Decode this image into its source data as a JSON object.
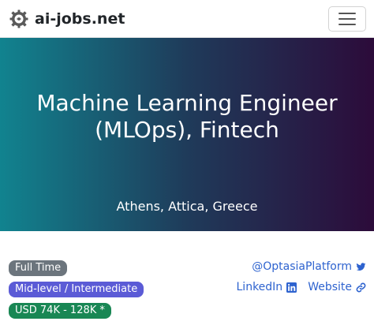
{
  "navbar": {
    "brand": "ai-jobs.net",
    "logo_icon": "gear-brain-logo-icon",
    "menu_icon": "hamburger-menu-icon"
  },
  "hero": {
    "title": "Machine Learning Engineer (MLOps), Fintech",
    "location": "Athens, Attica, Greece",
    "gradient": [
      "#11838f",
      "#1f3b5a",
      "#2c0b3a"
    ]
  },
  "badges": {
    "employment_type": "Full Time",
    "employment_type_color": "#6c757d",
    "level": "Mid-level / Intermediate",
    "level_color": "#5b5bd6",
    "salary": "USD 74K - 128K *",
    "salary_color": "#198754"
  },
  "links": {
    "twitter_handle": "@OptasiaPlatform",
    "twitter_icon": "twitter-icon",
    "linkedin_label": "LinkedIn",
    "linkedin_icon": "linkedin-icon",
    "website_label": "Website",
    "website_icon": "link-icon",
    "link_color": "#2e63cf"
  }
}
